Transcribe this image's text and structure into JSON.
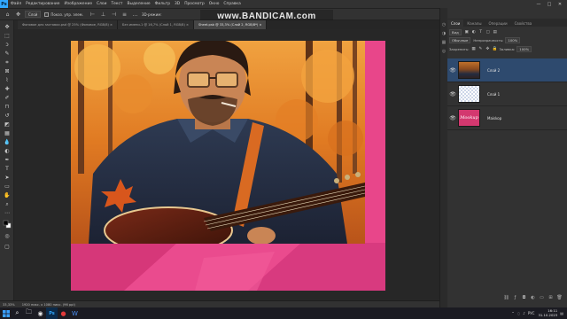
{
  "menubar": {
    "logo": "Ps",
    "items": [
      "Файл",
      "Редактирование",
      "Изображение",
      "Слои",
      "Текст",
      "Выделение",
      "Фильтр",
      "3D",
      "Просмотр",
      "Окно",
      "Справка"
    ],
    "window_buttons": [
      "—",
      "□",
      "✕"
    ]
  },
  "watermark": "www.BANDICAM.com",
  "options": {
    "tool_select": "Слой",
    "checkbox_label": "Показ. упр. элем.",
    "mode_label": "3D-режим:"
  },
  "tabs": [
    {
      "label": "Фоновое для заставки.psd @ 25% (Фоновое, RGB/8) ×",
      "active": false
    },
    {
      "label": "Без имени-1 @ 16,7% (Слой 1, RGB/8) ×",
      "active": false
    },
    {
      "label": "Sheet.psb @ 33,3% (Слой 2, RGB/8*) ×",
      "active": true
    }
  ],
  "status": {
    "zoom": "33,33%",
    "doc_info": "1920 пикс. x 1080 пикс. (96 ppi)"
  },
  "panel": {
    "tabs": [
      "Слои",
      "Каналы",
      "Операции",
      "Свойства"
    ],
    "search_label": "Вид",
    "blend_mode": "Обычные",
    "opacity_label": "Непрозрачность:",
    "opacity_value": "100%",
    "lock_label": "Закрепить:",
    "fill_label": "Заливка:",
    "fill_value": "100%",
    "layers": [
      {
        "name": "Слой 2",
        "thumb": "photo",
        "selected": true
      },
      {
        "name": "Слой 1",
        "thumb": "checker",
        "selected": false
      },
      {
        "name": "Maiskop",
        "thumb": "pink",
        "thumb_text": "Mookup",
        "selected": false
      }
    ]
  },
  "taskbar": {
    "tray_lang": "РУС",
    "time": "16:11",
    "date": "31.10.2023"
  }
}
